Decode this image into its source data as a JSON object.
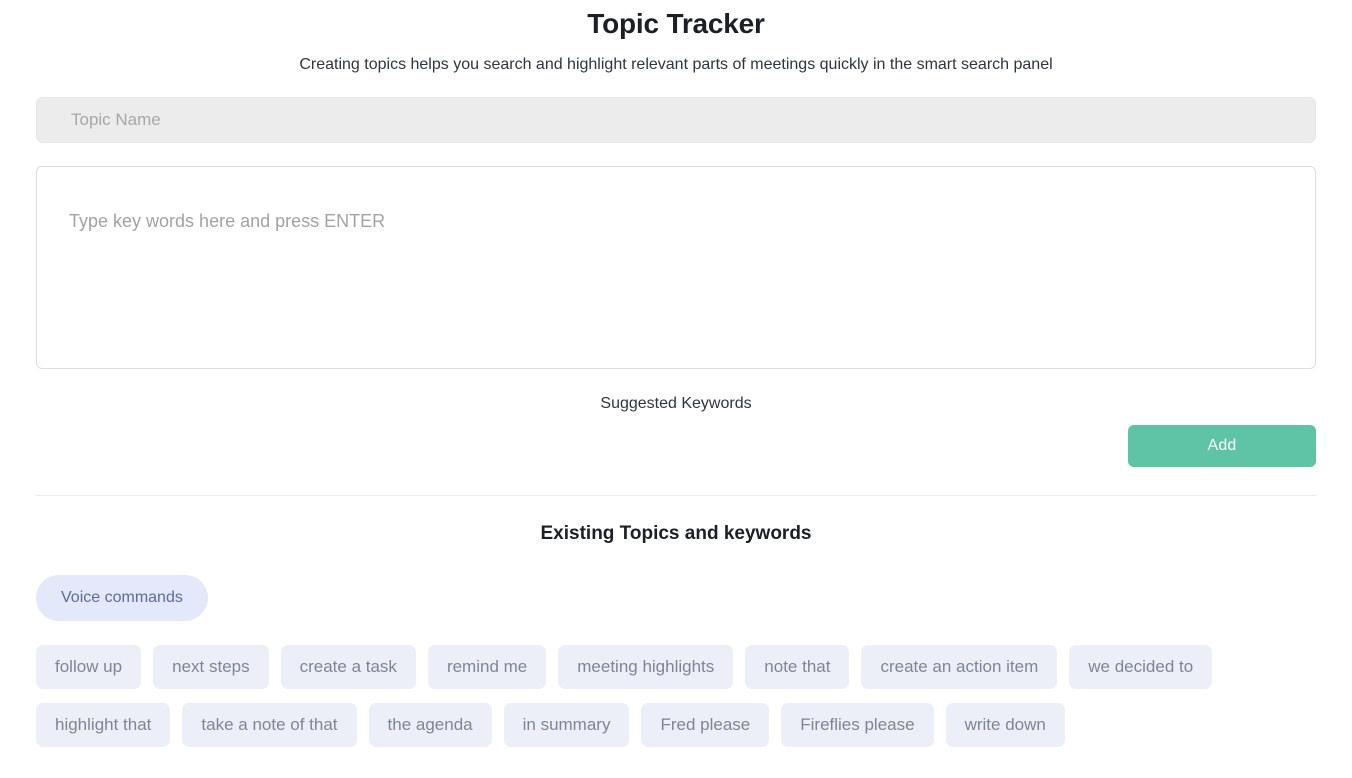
{
  "header": {
    "title": "Topic Tracker",
    "subtitle": "Creating topics helps you search and highlight relevant parts of meetings quickly in the smart search panel"
  },
  "form": {
    "topic_name": {
      "value": "",
      "placeholder": "Topic Name"
    },
    "keywords": {
      "value": "",
      "placeholder": "Type key words here and press ENTER"
    },
    "suggested_keywords_label": "Suggested Keywords",
    "add_label": "Add"
  },
  "existing": {
    "heading": "Existing Topics and keywords",
    "topics": [
      {
        "label": "Voice commands"
      }
    ],
    "keyword_rows": [
      [
        {
          "label": "follow up"
        },
        {
          "label": "next steps"
        },
        {
          "label": "create a task"
        },
        {
          "label": "remind me"
        },
        {
          "label": "meeting highlights"
        },
        {
          "label": "note that"
        },
        {
          "label": "create an action item"
        },
        {
          "label": "we decided to"
        }
      ],
      [
        {
          "label": "highlight that"
        },
        {
          "label": "take a note of that"
        },
        {
          "label": "the agenda"
        },
        {
          "label": "in summary"
        },
        {
          "label": "Fred please"
        },
        {
          "label": "Fireflies please"
        },
        {
          "label": "write down"
        }
      ]
    ]
  },
  "colors": {
    "accent_green": "#5fc3a5",
    "topic_chip_bg": "#e3e8fb",
    "topic_chip_text": "#5c6ba0",
    "keyword_chip_bg": "#eceff8",
    "keyword_chip_text": "#7e8694",
    "input_bg": "#ececec"
  }
}
